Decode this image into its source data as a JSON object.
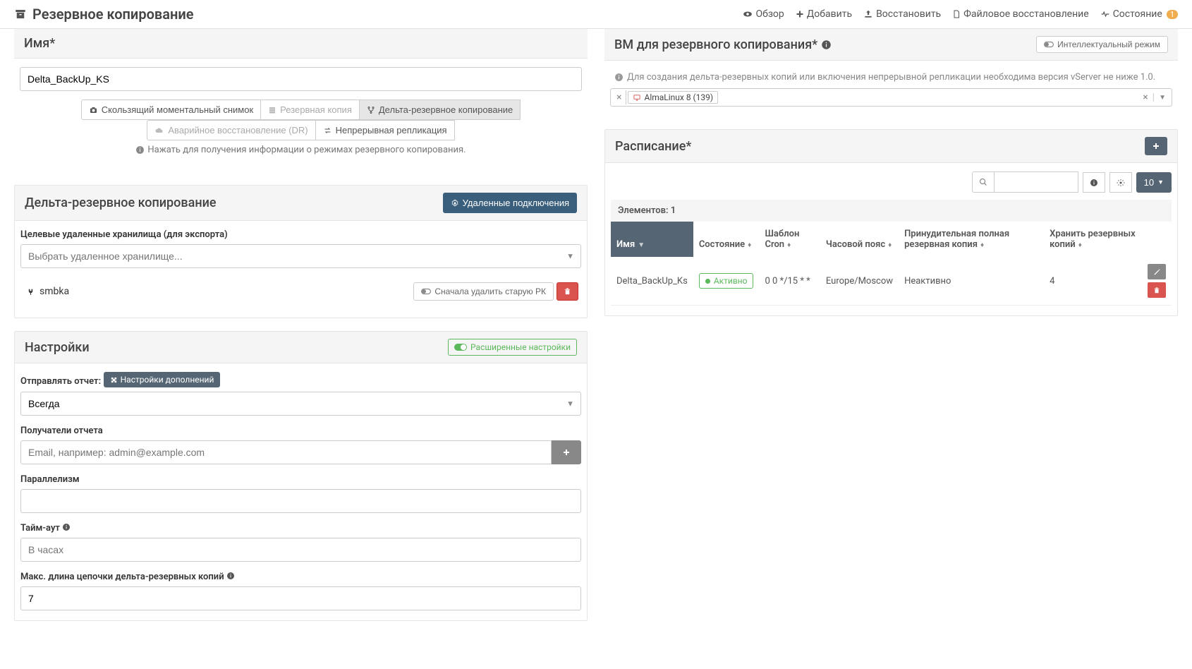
{
  "header": {
    "title": "Резервное копирование",
    "nav": {
      "overview": "Обзор",
      "add": "Добавить",
      "restore": "Восстановить",
      "file_restore": "Файловое восстановление",
      "status": "Состояние",
      "status_badge": "1"
    }
  },
  "name_section": {
    "title": "Имя*",
    "value": "Delta_BackUp_KS"
  },
  "modes": {
    "rolling": "Скользящий моментальный снимок",
    "backup": "Резервная копия",
    "delta": "Дельта-резервное копирование",
    "dr": "Аварийное восстановление (DR)",
    "cr": "Непрерывная репликация",
    "helper": "Нажать для получения информации о режимах резервного копирования."
  },
  "delta_section": {
    "title": "Дельта-резервное копирование",
    "remote_btn": "Удаленные подключения",
    "targets_label": "Целевые удаленные хранилища (для экспорта)",
    "targets_placeholder": "Выбрать удаленное хранилище...",
    "remote_name": "smbka",
    "delete_old": "Сначала удалить старую РК"
  },
  "settings": {
    "title": "Настройки",
    "advanced_toggle": "Расширенные настройки",
    "send_report_label": "Отправлять отчет:",
    "addon_btn": "Настройки дополнений",
    "send_report_value": "Всегда",
    "recipients_label": "Получатели отчета",
    "recipients_placeholder": "Email, например: admin@example.com",
    "parallel_label": "Параллелизм",
    "timeout_label": "Тайм-аут",
    "timeout_placeholder": "В часах",
    "chain_label": "Макс. длина цепочки дельта-резервных копий",
    "chain_value": "7"
  },
  "vm_section": {
    "title": "ВМ для резервного копирования*",
    "smart_mode": "Интеллектуальный режим",
    "info": "Для создания дельта-резервных копий или включения непрерывной репликации необходима версия vServer не ниже 1.0.",
    "vm_name": "AlmaLinux 8 (139)"
  },
  "schedule": {
    "title": "Расписание*",
    "page_size": "10",
    "count_label": "Элементов: 1",
    "cols": {
      "name": "Имя",
      "state": "Состояние",
      "cron": "Шаблон Cron",
      "tz": "Часовой пояс",
      "forced": "Принудительная полная резервная копия",
      "keep": "Хранить резервных копий"
    },
    "row": {
      "name": "Delta_BackUp_Ks",
      "state": "Активно",
      "cron": "0 0 */15 * *",
      "tz": "Europe/Moscow",
      "forced": "Неактивно",
      "keep": "4"
    }
  }
}
